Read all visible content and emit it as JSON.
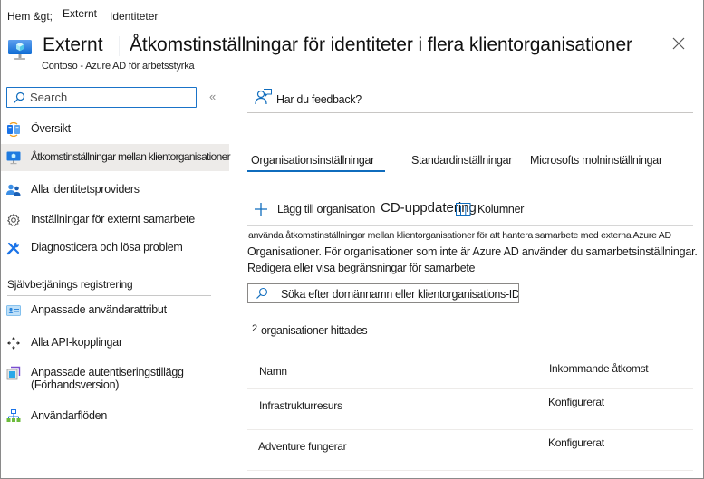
{
  "breadcrumb": [
    {
      "label": "Hem &gt;"
    },
    {
      "label": "Externt"
    },
    {
      "label": "Identiteter"
    }
  ],
  "header": {
    "app_name": "Externt",
    "title": "Åtkomstinställningar för identiteter i flera klientorganisationer",
    "subtitle": "Contoso - Azure AD för arbetsstyrka",
    "icon": "monitor-cube-icon",
    "close_icon": "close-icon"
  },
  "sidebar": {
    "search": {
      "placeholder": "Search",
      "value": ""
    },
    "collapse_label": "«",
    "items": [
      {
        "label": "Översikt",
        "icon": "overview-icon",
        "active": false
      },
      {
        "label": "Åtkomstinställningar mellan klientorganisationer",
        "icon": "monitor-icon",
        "active": true
      },
      {
        "label": "Alla identitetsproviders",
        "icon": "users-icon",
        "active": false
      },
      {
        "label": "Inställningar för externt samarbete",
        "icon": "gear-icon",
        "active": false
      },
      {
        "label": "Diagnosticera och lösa problem",
        "icon": "wrench-icon",
        "active": false
      }
    ],
    "section_title": "Självbetjänings registrering",
    "section_items": [
      {
        "label": "Anpassade användarattribut",
        "icon": "contact-card-icon"
      },
      {
        "label": "Alla API-kopplingar",
        "icon": "move-arrows-icon"
      },
      {
        "label": "Anpassade autentiseringstillägg",
        "label2": "(Förhandsversion)",
        "icon": "extension-icon"
      },
      {
        "label": "Användarflöden",
        "icon": "flow-hierarchy-icon"
      }
    ]
  },
  "main": {
    "feedback_label": "Har du feedback?",
    "tabs": [
      {
        "label": "Organisationsinställningar",
        "active": true
      },
      {
        "label": "Standardinställningar",
        "active": false
      },
      {
        "label": "Microsofts molninställningar",
        "active": false
      }
    ],
    "toolbar": {
      "add_label": "Lägg till organisation",
      "refresh_label": "CD-uppdatering",
      "columns_label": "Kolumner"
    },
    "description": {
      "line1": "använda åtkomstinställningar mellan klientorganisationer för att hantera samarbete med externa Azure AD",
      "line2": "Organisationer. För organisationer som inte är Azure AD använder du samarbetsinställningar.",
      "line3": "Redigera eller visa begränsningar för samarbete"
    },
    "org_search": {
      "placeholder": "Söka efter domännamn eller klientorganisations-ID",
      "value": ""
    },
    "result_count": "2",
    "result_label": "organisationer hittades",
    "table": {
      "columns": [
        "Namn",
        "Inkommande åtkomst"
      ],
      "rows": [
        [
          "Infrastrukturresurs",
          "Konfigurerat"
        ],
        [
          "Adventure fungerar",
          "Konfigurerat"
        ]
      ]
    }
  },
  "colors": {
    "accent": "#0f6cbd",
    "active_nav_bg": "#edebe9",
    "search_border": "#1a73c8"
  }
}
